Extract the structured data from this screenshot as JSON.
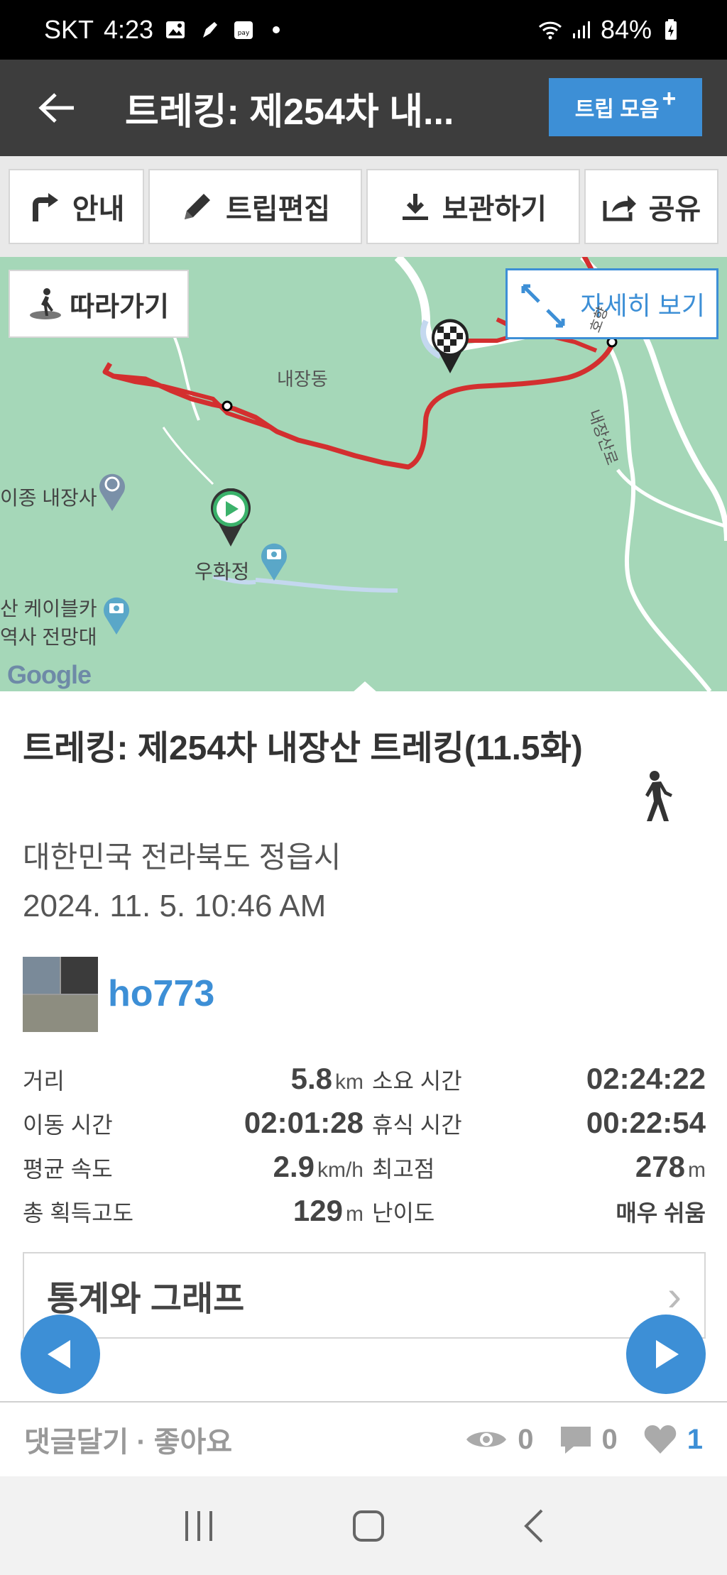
{
  "status_bar": {
    "carrier": "SKT",
    "time": "4:23",
    "battery": "84%",
    "icons": [
      "gallery-icon",
      "pen-icon",
      "pay-icon",
      "wifi-icon",
      "signal-icon",
      "battery-icon"
    ]
  },
  "app_bar": {
    "title": "트레킹: 제254차 내...",
    "trip_collect_label": "트립 모음",
    "trip_collect_plus": "+"
  },
  "toolbar": {
    "guide": "안내",
    "edit_trip": "트립편집",
    "save": "보관하기",
    "share": "공유"
  },
  "map": {
    "follow_label": "따라가기",
    "detail_label": "자세히 보기",
    "labels": {
      "naejang_dong": "내장동",
      "naejangsa": "이종 내장사",
      "uhwajeong": "우화정",
      "cable_car": "산 케이블카",
      "history_view": "역사 전망대",
      "road1": "내장산로",
      "road2": "호향"
    },
    "google": "Google",
    "route_color": "#d32f2f"
  },
  "trip": {
    "title": "트레킹: 제254차 내장산 트레킹(11.5화)",
    "location": "대한민국 전라북도 정읍시",
    "datetime": "2024. 11. 5. 10:46 AM",
    "username": "ho773",
    "activity_icon": "walking-icon"
  },
  "stats": {
    "distance_label": "거리",
    "distance_value": "5.8",
    "distance_unit": "km",
    "duration_label": "소요 시간",
    "duration_value": "02:24:22",
    "moving_label": "이동 시간",
    "moving_value": "02:01:28",
    "rest_label": "휴식 시간",
    "rest_value": "00:22:54",
    "avg_speed_label": "평균 속도",
    "avg_speed_value": "2.9",
    "avg_speed_unit": "km/h",
    "max_alt_label": "최고점",
    "max_alt_value": "278",
    "max_alt_unit": "m",
    "gain_label": "총 획득고도",
    "gain_value": "129",
    "gain_unit": "m",
    "difficulty_label": "난이도",
    "difficulty_value": "매우 쉬움"
  },
  "stats_graph": {
    "label": "통계와 그래프",
    "chevron": "›"
  },
  "footer": {
    "comment_like": "댓글달기 · 좋아요",
    "views": "0",
    "comments": "0",
    "likes": "1"
  },
  "colors": {
    "accent": "#3d8fd6",
    "app_bar": "#3d3d3d",
    "map_green": "#a5d7b8"
  }
}
